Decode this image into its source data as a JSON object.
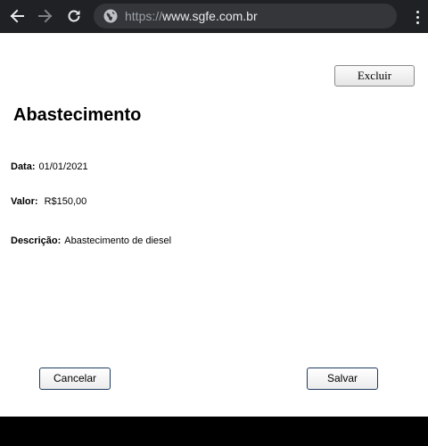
{
  "browser": {
    "url_scheme": "https://",
    "url_host": "www.sgfe.com.br",
    "icons": {
      "back": "back-arrow-icon",
      "forward": "forward-arrow-icon",
      "reload": "reload-icon",
      "site": "globe-icon",
      "menu": "more-vertical-icon"
    }
  },
  "page": {
    "delete_label": "Excluir",
    "title": "Abastecimento",
    "fields": {
      "date": {
        "label": "Data:",
        "value": "01/01/2021"
      },
      "amount": {
        "label": "Valor:",
        "value": "R$150,00"
      },
      "description": {
        "label": "Descrição:",
        "value": "Abastecimento de diesel"
      }
    },
    "cancel_label": "Cancelar",
    "save_label": "Salvar"
  },
  "colors": {
    "chrome_bg": "#202124",
    "omnibox_bg": "#35363a",
    "button_border_primary": "#1f3b62",
    "page_bg": "#ffffff"
  }
}
